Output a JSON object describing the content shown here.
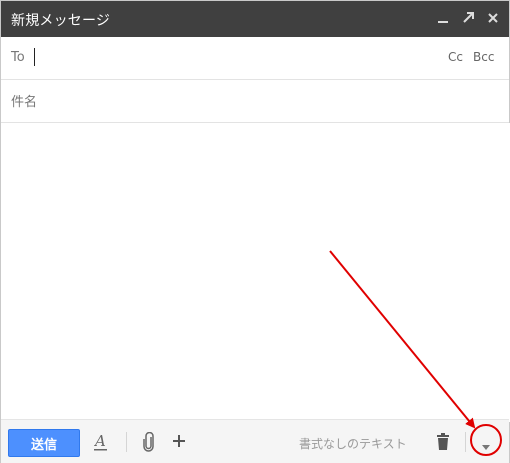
{
  "window": {
    "title": "新規メッセージ",
    "controls": [
      "minimize-icon",
      "expand-icon",
      "close-icon"
    ]
  },
  "compose": {
    "to_label": "To",
    "to_value": "",
    "cc_label": "Cc",
    "bcc_label": "Bcc",
    "subject_placeholder": "件名",
    "subject_value": "",
    "body_value": ""
  },
  "toolbar": {
    "send_label": "送信",
    "format_icon": "text-format-icon",
    "attach_icon": "paperclip-icon",
    "more_icon": "plus-icon",
    "plain_text_label": "書式なしのテキスト",
    "discard_icon": "trash-icon",
    "more_options_icon": "dropdown-arrow-icon"
  },
  "colors": {
    "titlebar": "#404040",
    "send_button": "#4d90fe",
    "annotation": "#e00000"
  }
}
